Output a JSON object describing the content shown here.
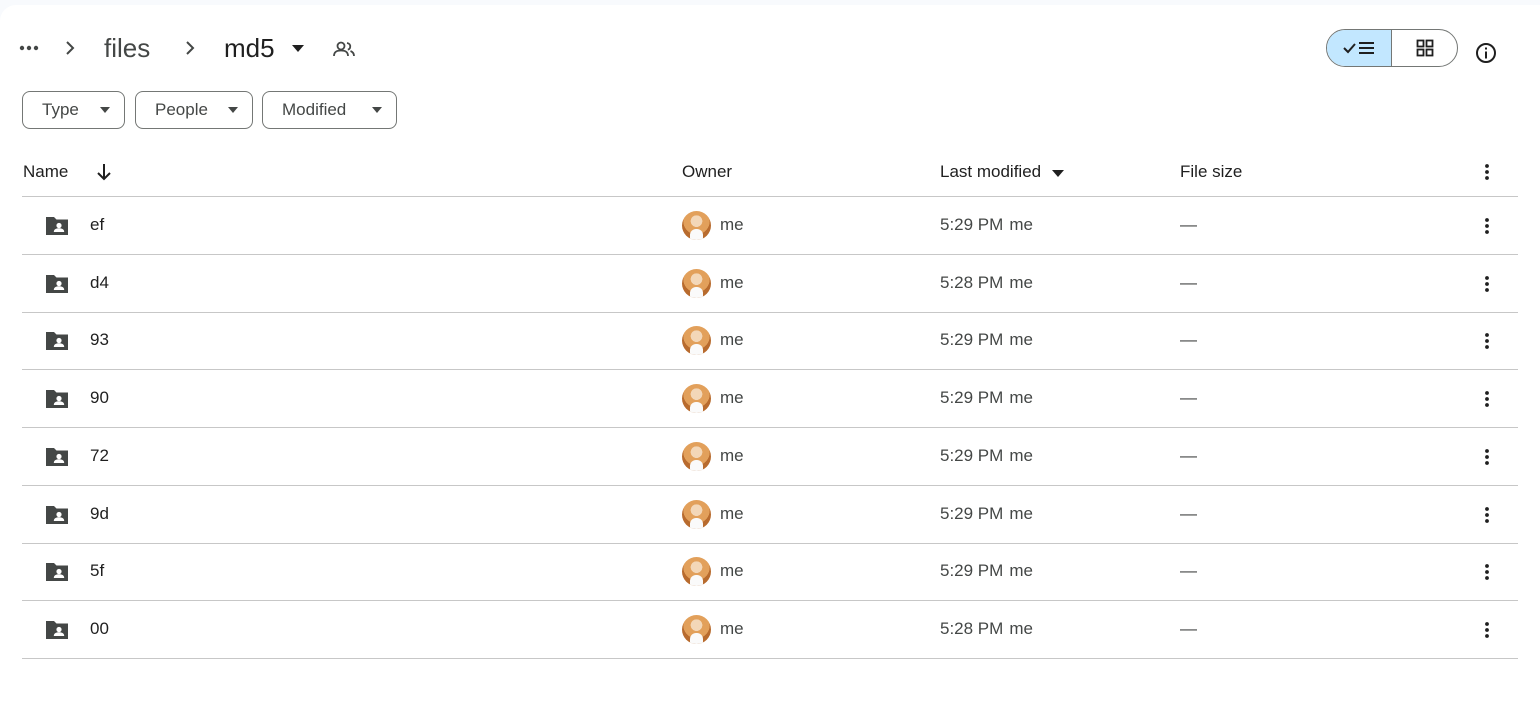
{
  "breadcrumb": {
    "more_icon": "more-horiz-icon",
    "items": [
      {
        "label": "files"
      },
      {
        "label": "md5"
      }
    ]
  },
  "view": {
    "list_selected": true,
    "list_icon": "check-list-icon",
    "grid_icon": "grid-icon",
    "info_icon": "info-icon"
  },
  "filters": [
    {
      "label": "Type"
    },
    {
      "label": "People"
    },
    {
      "label": "Modified"
    }
  ],
  "table": {
    "columns": {
      "name": "Name",
      "owner": "Owner",
      "last_modified": "Last modified",
      "file_size": "File size"
    },
    "rows": [
      {
        "name": "ef",
        "owner": "me",
        "modified": "5:29 PM",
        "modified_by": "me",
        "size": "—"
      },
      {
        "name": "d4",
        "owner": "me",
        "modified": "5:28 PM",
        "modified_by": "me",
        "size": "—"
      },
      {
        "name": "93",
        "owner": "me",
        "modified": "5:29 PM",
        "modified_by": "me",
        "size": "—"
      },
      {
        "name": "90",
        "owner": "me",
        "modified": "5:29 PM",
        "modified_by": "me",
        "size": "—"
      },
      {
        "name": "72",
        "owner": "me",
        "modified": "5:29 PM",
        "modified_by": "me",
        "size": "—"
      },
      {
        "name": "9d",
        "owner": "me",
        "modified": "5:29 PM",
        "modified_by": "me",
        "size": "—"
      },
      {
        "name": "5f",
        "owner": "me",
        "modified": "5:29 PM",
        "modified_by": "me",
        "size": "—"
      },
      {
        "name": "00",
        "owner": "me",
        "modified": "5:28 PM",
        "modified_by": "me",
        "size": "—"
      }
    ]
  },
  "colors": {
    "accent_selected": "#c2e7ff",
    "text": "#1f1f1f",
    "muted": "#444746",
    "divider": "#c7c7c7"
  }
}
